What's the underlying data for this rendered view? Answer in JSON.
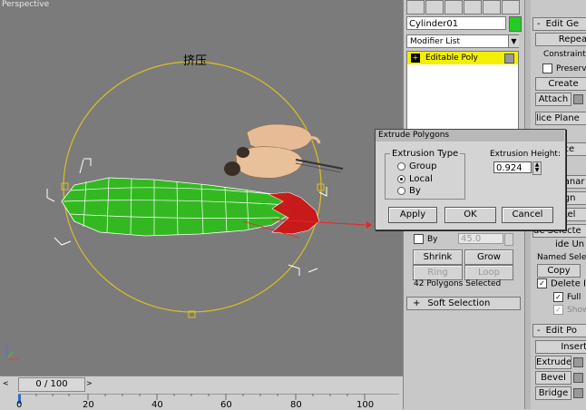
{
  "viewport": {
    "label": "Perspective",
    "annotation": "挤压"
  },
  "timeline": {
    "slider": "0 / 100",
    "ticks": [
      "0",
      "20",
      "40",
      "60",
      "80",
      "100"
    ]
  },
  "panel": {
    "object_name": "Cylinder01",
    "object_color": "#22cc22",
    "modifier_list": "Modifier List",
    "stack_item": "Editable Poly",
    "by_label": "By",
    "by_value": "45.0",
    "shrink": "Shrink",
    "grow": "Grow",
    "ring": "Ring",
    "loop": "Loop",
    "selection_status": "42 Polygons Selected",
    "soft_selection": "Soft Selection"
  },
  "far_panel": {
    "edit_geometry": "Edit Ge",
    "repeat": "Repeat",
    "constraints": "Constraints:",
    "preserve": "Preserv",
    "create": "Create",
    "attach": "Attach",
    "slice_plane": "lice Plane",
    "slice": "lice",
    "planar": "lanar",
    "align": "ign",
    "relax": "Rel",
    "hide_selected": "de Selecte",
    "hide_unselected": "ide Un",
    "named_selections": "Named Selecti",
    "copy": "Copy",
    "delete_isolated": "Delete I",
    "full": "Full",
    "show": "Show",
    "edit_polygons": "Edit Po",
    "insert": "Insert",
    "extrude": "Extrude",
    "bevel": "Bevel",
    "bridge": "Bridge"
  },
  "dialog": {
    "title": "Extrude Polygons",
    "extrusion_type": "Extrusion Type",
    "options": [
      "Group",
      "Local",
      "By"
    ],
    "selected": "Local",
    "height_label": "Extrusion Height:",
    "height_value": "0.924",
    "apply": "Apply",
    "ok": "OK",
    "cancel": "Cancel"
  },
  "colors": {
    "viewport_bg": "#7b7b7b",
    "mesh_green": "#33bb22",
    "selected_red": "#dd1111",
    "gizmo_yellow": "#e0c020"
  }
}
